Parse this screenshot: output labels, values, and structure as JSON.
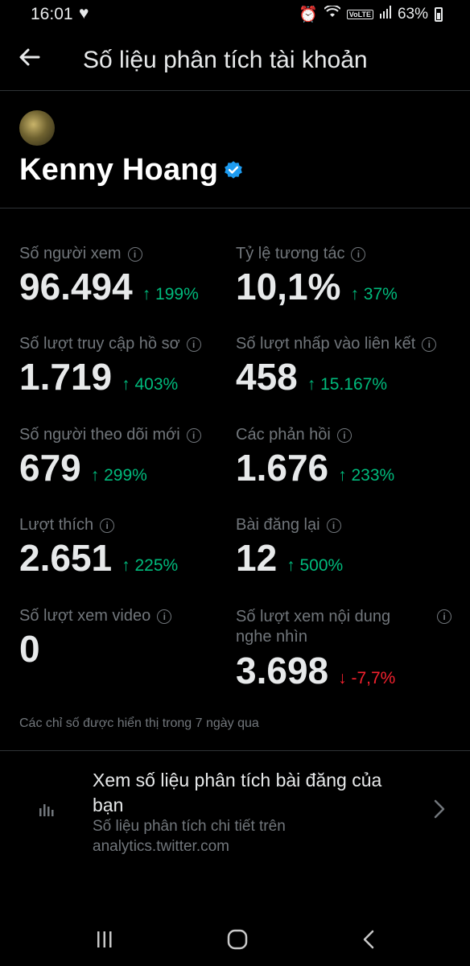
{
  "status_bar": {
    "time": "16:01",
    "battery": "63%",
    "volte": "VoLTE",
    "icons": [
      "heart-icon",
      "alarm-icon",
      "wifi-icon",
      "signal-icon",
      "battery-icon"
    ]
  },
  "header": {
    "title": "Số liệu phân tích tài khoản",
    "back_icon": "arrow-left-icon"
  },
  "profile": {
    "name": "Kenny Hoang",
    "verified_icon": "verified-badge-icon",
    "badge_color": "#1d9bf0"
  },
  "metrics": [
    {
      "label": "Số người xem",
      "value": "96.494",
      "change": "↑ 199%",
      "direction": "up"
    },
    {
      "label": "Tỷ lệ tương tác",
      "value": "10,1%",
      "change": "↑ 37%",
      "direction": "up"
    },
    {
      "label": "Số lượt truy cập hồ sơ",
      "value": "1.719",
      "change": "↑ 403%",
      "direction": "up"
    },
    {
      "label": "Số lượt nhấp vào liên kết",
      "value": "458",
      "change": "↑ 15.167%",
      "direction": "up"
    },
    {
      "label": "Số người theo dõi mới",
      "value": "679",
      "change": "↑ 299%",
      "direction": "up"
    },
    {
      "label": "Các phản hồi",
      "value": "1.676",
      "change": "↑ 233%",
      "direction": "up"
    },
    {
      "label": "Lượt thích",
      "value": "2.651",
      "change": "↑ 225%",
      "direction": "up"
    },
    {
      "label": "Bài đăng lại",
      "value": "12",
      "change": "↑ 500%",
      "direction": "up"
    },
    {
      "label": "Số lượt xem video",
      "value": "0",
      "change": "",
      "direction": "none"
    },
    {
      "label": "Số lượt xem nội dung nghe nhìn",
      "value": "3.698",
      "change": "↓ -7,7%",
      "direction": "down"
    }
  ],
  "colors": {
    "positive": "#00ba7c",
    "negative": "#f4212e",
    "muted": "#71767b"
  },
  "footnote": "Các chỉ số được hiển thị trong 7 ngày qua",
  "analytics_link": {
    "title": "Xem số liệu phân tích bài đăng của bạn",
    "subtitle": "Số liệu phân tích chi tiết trên analytics.twitter.com",
    "icon": "bar-chart-icon",
    "chevron_icon": "chevron-right-icon"
  },
  "nav_bar": {
    "recents_icon": "recents-icon",
    "home_icon": "home-icon",
    "back_icon": "back-icon"
  }
}
